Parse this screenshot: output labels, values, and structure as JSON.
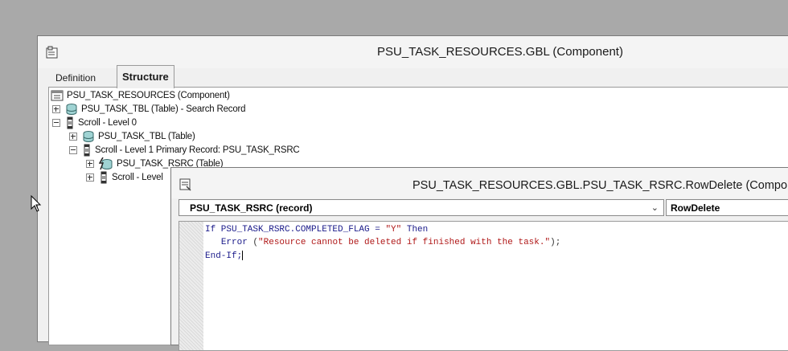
{
  "component_window": {
    "title": "PSU_TASK_RESOURCES.GBL (Component)",
    "tabs": [
      {
        "label": "Definition",
        "active": false
      },
      {
        "label": "Structure",
        "active": true
      }
    ]
  },
  "tree": [
    {
      "label": "PSU_TASK_RESOURCES (Component)",
      "icon": "component-icon",
      "expander": "none"
    },
    {
      "label": "PSU_TASK_TBL (Table) - Search Record",
      "icon": "table-icon",
      "expander": "plus"
    },
    {
      "label": "Scroll - Level 0",
      "icon": "scroll-icon",
      "expander": "minus"
    },
    {
      "label": "PSU_TASK_TBL (Table)",
      "icon": "table-icon",
      "expander": "plus"
    },
    {
      "label": "Scroll - Level 1  Primary Record: PSU_TASK_RSRC",
      "icon": "scroll-icon",
      "expander": "minus"
    },
    {
      "label": "PSU_TASK_RSRC (Table)",
      "icon": "peoplecode-table-icon",
      "expander": "plus"
    },
    {
      "label": "Scroll - Level",
      "icon": "scroll-icon",
      "expander": "plus"
    }
  ],
  "code_window": {
    "title": "PSU_TASK_RESOURCES.GBL.PSU_TASK_RSRC.RowDelete (Compone",
    "record_select": "PSU_TASK_RSRC   (record)",
    "event_select": "RowDelete",
    "code": {
      "line1_kw1": "If",
      "line1_expr": " PSU_TASK_RSRC.COMPLETED_FLAG = ",
      "line1_str": "\"Y\"",
      "line1_kw2": " Then",
      "line2_kw": "Error",
      "line2_open": " (",
      "line2_str": "\"Resource cannot be deleted if finished with the task.\"",
      "line2_close": ");",
      "line3_kw": "End-If;"
    }
  },
  "colors": {
    "desktop": "#a9a9a9",
    "keyword": "#1a1a8a",
    "string": "#b01818"
  }
}
